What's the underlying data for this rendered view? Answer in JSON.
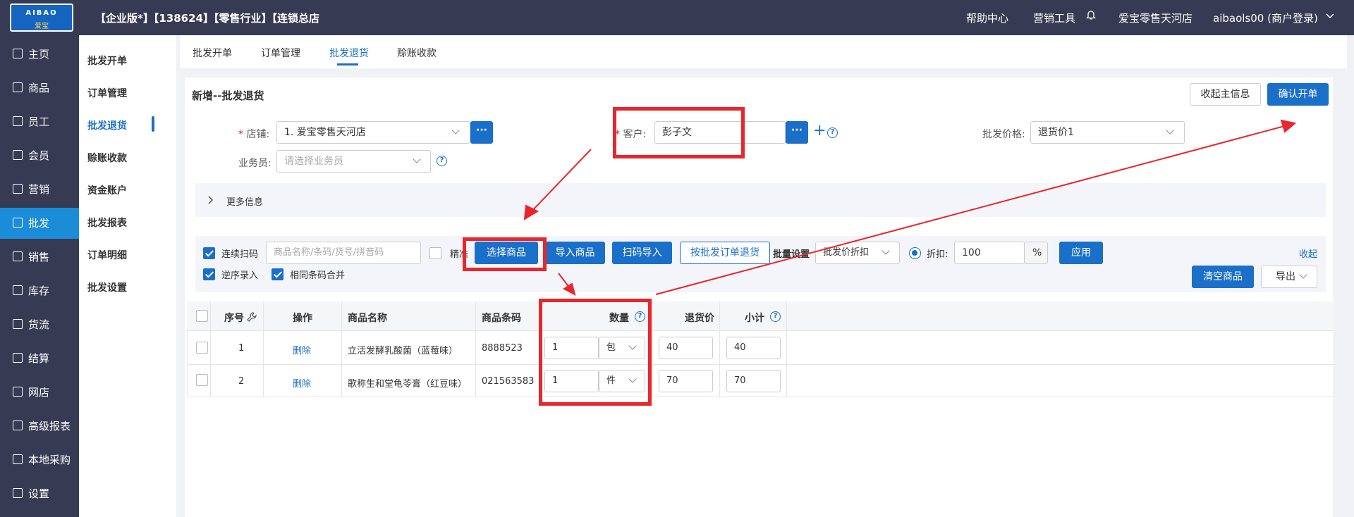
{
  "header": {
    "logo_text": "AIBAO",
    "logo_sub": "爱宝",
    "title": "【企业版*】【138624】【零售行业】【连锁总店",
    "help": "帮助中心",
    "marketing_tools": "营销工具",
    "store": "爱宝零售天河店",
    "user": "aibaols00 (商户登录)"
  },
  "nav": [
    {
      "label": "主页"
    },
    {
      "label": "商品"
    },
    {
      "label": "员工"
    },
    {
      "label": "会员"
    },
    {
      "label": "营销"
    },
    {
      "label": "批发"
    },
    {
      "label": "销售"
    },
    {
      "label": "库存"
    },
    {
      "label": "货流"
    },
    {
      "label": "结算"
    },
    {
      "label": "网店"
    },
    {
      "label": "高级报表"
    },
    {
      "label": "本地采购"
    },
    {
      "label": "设置"
    }
  ],
  "subnav": [
    {
      "label": "批发开单"
    },
    {
      "label": "订单管理"
    },
    {
      "label": "批发退货"
    },
    {
      "label": "赊账收款"
    },
    {
      "label": "资金账户"
    },
    {
      "label": "批发报表"
    },
    {
      "label": "订单明细"
    },
    {
      "label": "批发设置"
    }
  ],
  "tabs": [
    {
      "label": "批发开单"
    },
    {
      "label": "订单管理"
    },
    {
      "label": "批发退货"
    },
    {
      "label": "赊账收款"
    }
  ],
  "panel": {
    "title": "新增--批发退货",
    "collapse_btn": "收起主信息",
    "confirm_btn": "确认开单"
  },
  "form": {
    "store_label": "店铺:",
    "store_value": "1. 爱宝零售天河店",
    "customer_label": "客户:",
    "customer_value": "彭子文",
    "price_label": "批发价格:",
    "price_value": "退货价1",
    "salesman_label": "业务员:",
    "salesman_placeholder": "请选择业务员",
    "more_info": "更多信息"
  },
  "toolbar": {
    "continuous_scan": "连续扫码",
    "search_placeholder": "商品名称/条码/货号/拼音码",
    "exact": "精准",
    "select_goods": "选择商品",
    "import_goods": "导入商品",
    "scan_import": "扫码导入",
    "return_by_order": "按批发订单退货",
    "batch_setting": "批量设置",
    "batch_mode": "批发价折扣",
    "discount_label": "折扣:",
    "discount_value": "100",
    "percent": "%",
    "apply": "应用",
    "collapse": "收起",
    "reverse_input": "逆序录入",
    "merge_barcode": "相同条码合并",
    "clear_goods": "清空商品",
    "export": "导出"
  },
  "table": {
    "headers": {
      "seq": "序号",
      "op": "操作",
      "name": "商品名称",
      "barcode": "商品条码",
      "qty": "数量",
      "price": "退货价",
      "subtotal": "小计"
    },
    "rows": [
      {
        "seq": "1",
        "op": "删除",
        "name": "立活发酵乳酸菌（蓝莓味）",
        "barcode": "8888523",
        "qty": "1",
        "unit": "包",
        "price": "40",
        "subtotal": "40"
      },
      {
        "seq": "2",
        "op": "删除",
        "name": "歌称生和堂龟苓膏（红豆味）",
        "barcode": "021563583",
        "qty": "1",
        "unit": "件",
        "price": "70",
        "subtotal": "70"
      }
    ]
  },
  "colors": {
    "accent": "#1a6fc9",
    "nav_active": "#1a8cd8",
    "sidebar": "#363a53",
    "annotation": "#e8262b"
  }
}
